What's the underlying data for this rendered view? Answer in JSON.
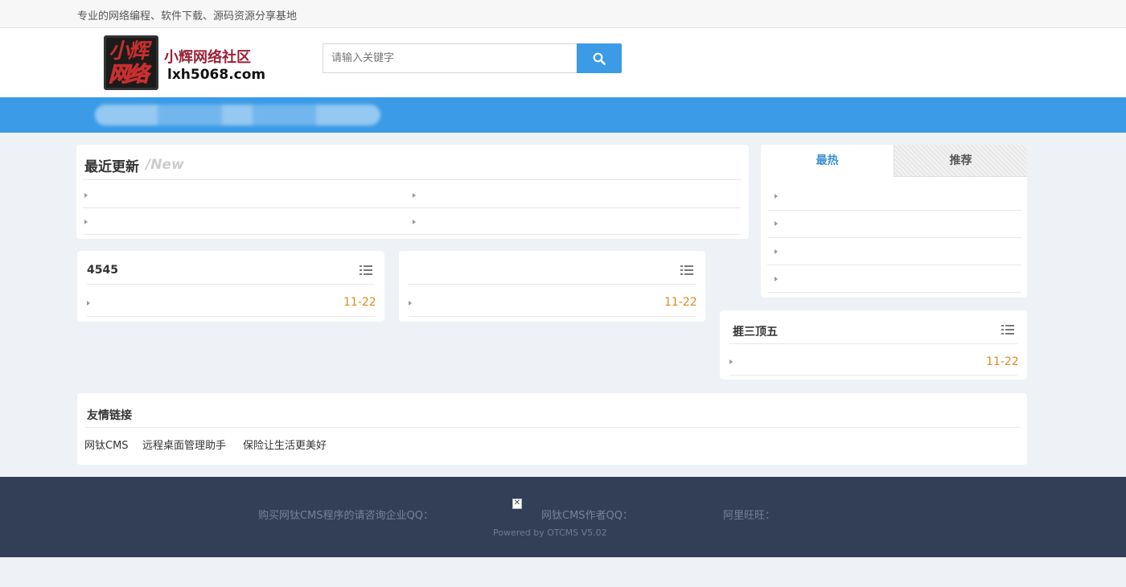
{
  "topbar": {
    "tagline": "专业的网络编程、软件下载、源码资源分享基地"
  },
  "logo": {
    "line1": "小辉",
    "line2": "网络",
    "name": "小辉网络社区",
    "domain": "lxh5068.com"
  },
  "search": {
    "placeholder": "请输入关键字",
    "button_icon": "search-icon"
  },
  "recent": {
    "title": "最近更新",
    "subtitle": "/New"
  },
  "rank": {
    "tabs": [
      {
        "label": "最热",
        "active": true
      },
      {
        "label": "推荐",
        "active": false
      }
    ]
  },
  "cards": [
    {
      "title": "4545",
      "date": "11-22"
    },
    {
      "title": "",
      "date": "11-22"
    },
    {
      "title": "捱三顶五",
      "date": "11-22"
    }
  ],
  "friends": {
    "title": "友情链接",
    "links": [
      "网钛CMS",
      "远程桌面管理助手",
      "保险让生活更美好"
    ]
  },
  "footer": {
    "buy_qq": "购买网钛CMS程序的请咨询企业QQ：",
    "author_qq": "网钛CMS作者QQ：",
    "aliwangwang": "阿里旺旺：",
    "powered": "Powered by OTCMS V5.02"
  },
  "colors": {
    "accent": "#3b9be6",
    "date": "#e08a1e",
    "footer_bg": "#323f57",
    "tab_active": "#3b8fd4"
  }
}
